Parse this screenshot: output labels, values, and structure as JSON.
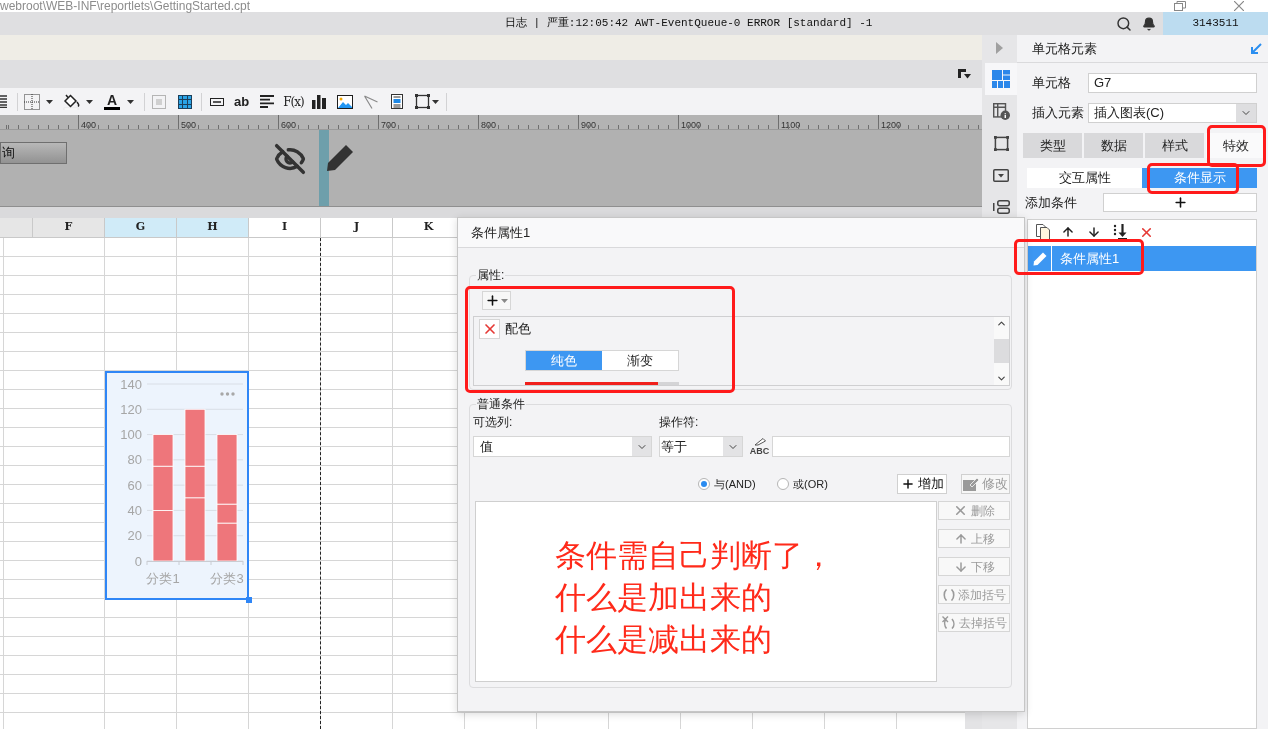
{
  "window": {
    "path": "webroot\\WEB-INF\\reportlets\\GettingStarted.cpt"
  },
  "log_bar": {
    "message": "日志 | 严重:12:05:42 AWT-EventQueue-0 ERROR [standard] -1",
    "user_id": "3143511"
  },
  "toolbar": {
    "font_color_glyph": "A",
    "text_glyph": "ab",
    "formula_glyph": "F(x)"
  },
  "ruler": {
    "labels": [
      "400",
      "500",
      "600",
      "700",
      "800",
      "900",
      "1000",
      "1100",
      "1200"
    ]
  },
  "parameter_pane": {
    "button_label": "询"
  },
  "sheet": {
    "columns": [
      {
        "label": "F",
        "selected": false,
        "shaded": true
      },
      {
        "label": "G",
        "selected": true,
        "shaded": false
      },
      {
        "label": "H",
        "selected": true,
        "shaded": false
      },
      {
        "label": "I",
        "selected": false,
        "shaded": false
      },
      {
        "label": "J",
        "selected": false,
        "shaded": false
      },
      {
        "label": "K",
        "selected": false,
        "shaded": false
      }
    ],
    "chart": {
      "chart_data": {
        "type": "bar",
        "categories": [
          "分类1",
          null,
          "分类3"
        ],
        "series": [
          {
            "color": "#ee767b",
            "values": [
              40,
              50,
              30
            ]
          },
          {
            "color": "#ee767b",
            "values": [
              35,
              25,
              15
            ]
          },
          {
            "color": "#ee767b",
            "values": [
              25,
              45,
              55
            ]
          }
        ],
        "stacked": true,
        "grid": true,
        "ylim": [
          0,
          140
        ],
        "yticks": [
          0,
          20,
          40,
          60,
          80,
          100,
          120,
          140
        ]
      }
    }
  },
  "dialog": {
    "title": "条件属性1",
    "properties_label": "属性:",
    "properties": [
      {
        "name": "配色",
        "modes": [
          {
            "label": "纯色",
            "selected": true
          },
          {
            "label": "渐变",
            "selected": false
          }
        ]
      }
    ],
    "conditions_label": "普通条件",
    "column_label": "可选列:",
    "column_value": "值",
    "operator_label": "操作符:",
    "operator_value": "等于",
    "formula_glyph": "ABC",
    "logic": [
      {
        "label": "与(AND)",
        "selected": true
      },
      {
        "label": "或(OR)",
        "selected": false
      }
    ],
    "add_button": {
      "label": "增加",
      "disabled": false
    },
    "edit_button": {
      "label": "修改",
      "disabled": true
    },
    "side_buttons": [
      {
        "kind": "delete",
        "label": "删除",
        "disabled": true
      },
      {
        "kind": "up",
        "label": "上移",
        "disabled": true
      },
      {
        "kind": "down",
        "label": "下移",
        "disabled": true
      },
      {
        "kind": "add_brackets",
        "label": "添加括号",
        "disabled": true
      },
      {
        "kind": "remove_brackets",
        "label": "去掉括号",
        "disabled": true
      }
    ],
    "note_lines": [
      "条件需自己判断了，",
      "什么是加出来的",
      "什么是减出来的"
    ]
  },
  "side_tabs": [
    {
      "kind": "grid",
      "selected": true
    },
    {
      "kind": "info",
      "selected": false
    },
    {
      "kind": "square",
      "selected": false
    },
    {
      "kind": "dropdown",
      "selected": false
    },
    {
      "kind": "stack",
      "selected": false
    }
  ],
  "panel": {
    "title": "单元格元素",
    "cell_label": "单元格",
    "cell_value": "G7",
    "insert_label": "插入元素",
    "insert_value": "插入图表(C)",
    "tabs": [
      {
        "label": "类型",
        "selected": false
      },
      {
        "label": "数据",
        "selected": false
      },
      {
        "label": "样式",
        "selected": false
      },
      {
        "label": "特效",
        "selected": true
      }
    ],
    "subtabs": [
      {
        "label": "交互属性",
        "selected": false
      },
      {
        "label": "条件显示",
        "selected": true
      }
    ],
    "add_condition_label": "添加条件",
    "conditions": [
      {
        "label": "条件属性1",
        "selected": true
      }
    ]
  }
}
